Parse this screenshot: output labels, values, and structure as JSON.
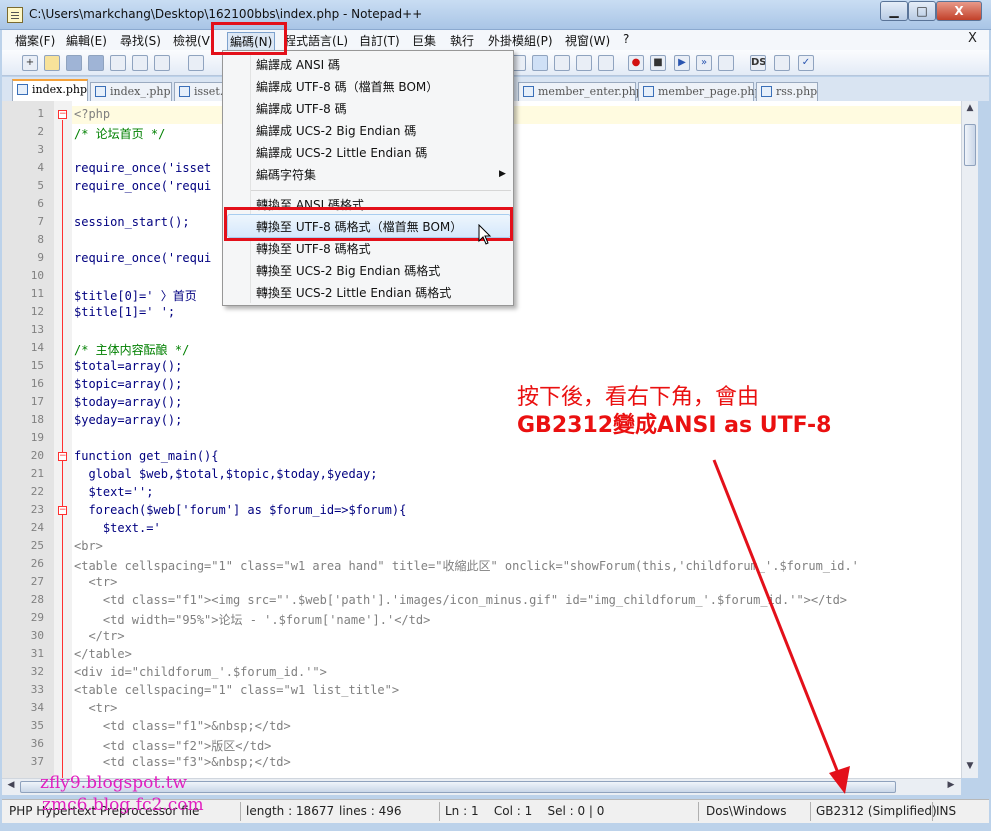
{
  "window": {
    "title": "C:\\Users\\markchang\\Desktop\\162100bbs\\index.php - Notepad++",
    "min_label": "▁",
    "max_label": "□",
    "close_label": "X"
  },
  "menubar": {
    "items": [
      "檔案(F)",
      "編輯(E)",
      "尋找(S)",
      "檢視(V)",
      "編碼(N)",
      "程式語言(L)",
      "自訂(T)",
      "巨集",
      "執行",
      "外掛模組(P)",
      "視窗(W)",
      "?"
    ],
    "mdi_close": "X"
  },
  "tabs": [
    {
      "label": "index.php",
      "active": true
    },
    {
      "label": "index_.php",
      "active": false
    },
    {
      "label": "isset.p",
      "active": false
    },
    {
      "label": "member_enter.php",
      "active": false
    },
    {
      "label": "member_page.php",
      "active": false
    },
    {
      "label": "rss.php",
      "active": false
    }
  ],
  "encoding_menu": {
    "items": [
      "編譯成 ANSI 碼",
      "編譯成 UTF-8 碼（檔首無 BOM）",
      "編譯成 UTF-8 碼",
      "編譯成 UCS-2 Big Endian 碼",
      "編譯成 UCS-2 Little Endian 碼",
      "編碼字符集",
      "轉換至 ANSI 碼格式",
      "轉換至 UTF-8 碼格式（檔首無 BOM）",
      "轉換至 UTF-8 碼格式",
      "轉換至 UCS-2 Big Endian 碼格式",
      "轉換至 UCS-2 Little Endian 碼格式"
    ],
    "submenu_arrow": "▶"
  },
  "editor": {
    "line_numbers": [
      "1",
      "2",
      "3",
      "4",
      "5",
      "6",
      "7",
      "8",
      "9",
      "10",
      "11",
      "12",
      "13",
      "14",
      "15",
      "16",
      "17",
      "18",
      "19",
      "20",
      "21",
      "22",
      "23",
      "24",
      "25",
      "26",
      "27",
      "28",
      "29",
      "30",
      "31",
      "32",
      "33",
      "34",
      "35",
      "36",
      "37"
    ],
    "fold_marker": "−",
    "lines": [
      "<?php",
      "/* 论坛首页 */",
      "",
      "require_once('isset",
      "require_once('requi",
      "",
      "session_start();",
      "",
      "require_once('requi",
      "",
      "$title[0]=' 〉首页",
      "$title[1]=' ';",
      "",
      "/* 主体内容酝酿 */",
      "$total=array();",
      "$topic=array();",
      "$today=array();",
      "$yeday=array();",
      "",
      "function get_main(){",
      "  global $web,$total,$topic,$today,$yeday;",
      "  $text='';",
      "  foreach($web['forum'] as $forum_id=>$forum){",
      "    $text.='",
      "<br>",
      "<table cellspacing=\"1\" class=\"w1 area hand\" title=\"收縮此区\" onclick=\"showForum(this,'childforum_'.$forum_id.'",
      "  <tr>",
      "    <td class=\"f1\"><img src=\"'.$web['path'].'images/icon_minus.gif\" id=\"img_childforum_'.$forum_id.'\"></td>",
      "    <td width=\"95%\">论坛 - '.$forum['name'].'</td>",
      "  </tr>",
      "</table>",
      "<div id=\"childforum_'.$forum_id.'\">",
      "<table cellspacing=\"1\" class=\"w1 list_title\">",
      "  <tr>",
      "    <td class=\"f1\">&nbsp;</td>",
      "    <td class=\"f2\">版区</td>",
      "    <td class=\"f3\">&nbsp;</td>"
    ]
  },
  "statusbar": {
    "file_type": "PHP Hypertext Preprocessor file",
    "length": "length : 18677",
    "lines": "lines : 496",
    "position": "Ln : 1    Col : 1    Sel : 0 | 0",
    "eol": "Dos\\Windows",
    "encoding": "GB2312 (Simplified)",
    "mode": "INS"
  },
  "annotation": {
    "line1": "按下後，看右下角，會由",
    "line2": "GB2312變成ANSI as UTF-8"
  },
  "watermark": {
    "line1": "zfly9.blogspot.tw",
    "line2": "zmc6.blog.fc2.com"
  },
  "colors": {
    "highlight": "#e3101a",
    "keyword": "#0000ff",
    "comment": "#008000",
    "string": "#808080",
    "watermark": "#e11fbf"
  }
}
